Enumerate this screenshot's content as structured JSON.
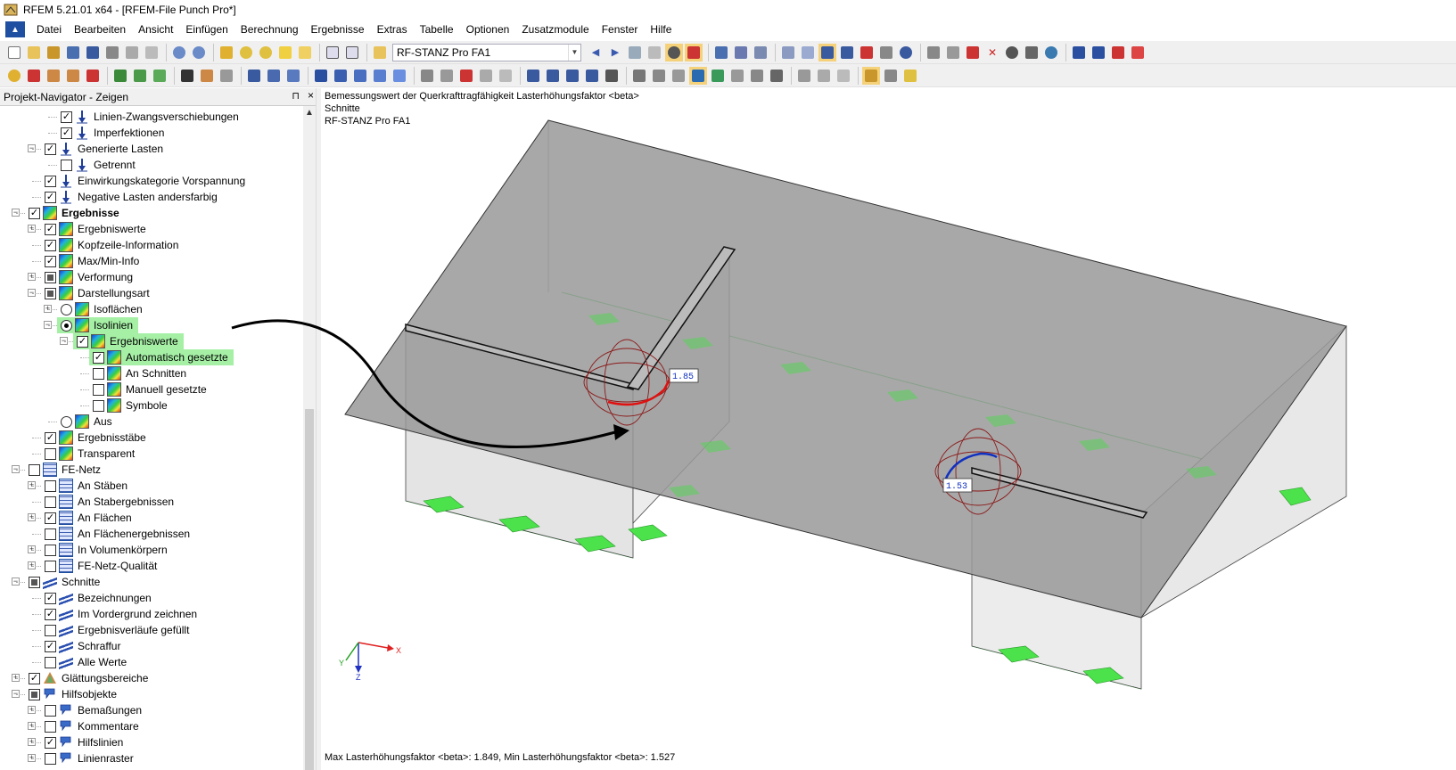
{
  "window": {
    "title": "RFEM 5.21.01 x64 - [RFEM-File Punch Pro*]"
  },
  "menu": [
    "Datei",
    "Bearbeiten",
    "Ansicht",
    "Einfügen",
    "Berechnung",
    "Ergebnisse",
    "Extras",
    "Tabelle",
    "Optionen",
    "Zusatzmodule",
    "Fenster",
    "Hilfe"
  ],
  "toolbar": {
    "combo_value": "RF-STANZ Pro FA1"
  },
  "navigator": {
    "title": "Projekt-Navigator - Zeigen",
    "items": [
      {
        "label": "Linien-Zwangsverschiebungen",
        "check": "on",
        "icon": "load"
      },
      {
        "label": "Imperfektionen",
        "check": "on",
        "icon": "load"
      },
      {
        "label": "Generierte Lasten",
        "check": "on",
        "icon": "load"
      },
      {
        "label": "Getrennt",
        "check": "off",
        "icon": "load"
      },
      {
        "label": "Einwirkungskategorie Vorspannung",
        "check": "on",
        "icon": "load"
      },
      {
        "label": "Negative Lasten andersfarbig",
        "check": "on",
        "icon": "load"
      },
      {
        "label": "Ergebnisse",
        "check": "on",
        "icon": "res"
      },
      {
        "label": "Ergebniswerte",
        "check": "on",
        "icon": "res"
      },
      {
        "label": "Kopfzeile-Information",
        "check": "on",
        "icon": "res"
      },
      {
        "label": "Max/Min-Info",
        "check": "on",
        "icon": "res"
      },
      {
        "label": "Verformung",
        "check": "partial",
        "icon": "res"
      },
      {
        "label": "Darstellungsart",
        "check": "partial",
        "icon": "res"
      },
      {
        "label": "Isoflächen",
        "check": "radio-off",
        "icon": "res"
      },
      {
        "label": "Isolinien",
        "check": "radio-on",
        "icon": "res"
      },
      {
        "label": "Ergebniswerte",
        "check": "on",
        "icon": "res"
      },
      {
        "label": "Automatisch gesetzte",
        "check": "on",
        "icon": "res"
      },
      {
        "label": "An Schnitten",
        "check": "off",
        "icon": "res"
      },
      {
        "label": "Manuell gesetzte",
        "check": "off",
        "icon": "res"
      },
      {
        "label": "Symbole",
        "check": "off",
        "icon": "res"
      },
      {
        "label": "Aus",
        "check": "radio-off",
        "icon": "res"
      },
      {
        "label": "Ergebnisstäbe",
        "check": "on",
        "icon": "res"
      },
      {
        "label": "Transparent",
        "check": "off",
        "icon": "res"
      },
      {
        "label": "FE-Netz",
        "check": "off",
        "icon": "mesh"
      },
      {
        "label": "An Stäben",
        "check": "off",
        "icon": "mesh"
      },
      {
        "label": "An Stabergebnissen",
        "check": "off",
        "icon": "mesh"
      },
      {
        "label": "An Flächen",
        "check": "on",
        "icon": "mesh"
      },
      {
        "label": "An Flächenergebnissen",
        "check": "off",
        "icon": "mesh"
      },
      {
        "label": "In Volumenkörpern",
        "check": "off",
        "icon": "mesh"
      },
      {
        "label": "FE-Netz-Qualität",
        "check": "off",
        "icon": "mesh"
      },
      {
        "label": "Schnitte",
        "check": "partial",
        "icon": "cut"
      },
      {
        "label": "Bezeichnungen",
        "check": "on",
        "icon": "cut"
      },
      {
        "label": "Im Vordergrund zeichnen",
        "check": "on",
        "icon": "cut"
      },
      {
        "label": "Ergebnisverläufe gefüllt",
        "check": "off",
        "icon": "cut"
      },
      {
        "label": "Schraffur",
        "check": "on",
        "icon": "cut"
      },
      {
        "label": "Alle Werte",
        "check": "off",
        "icon": "cut"
      },
      {
        "label": "Glättungsbereiche",
        "check": "on",
        "icon": "smooth"
      },
      {
        "label": "Hilfsobjekte",
        "check": "partial",
        "icon": "aux"
      },
      {
        "label": "Bemaßungen",
        "check": "off",
        "icon": "aux"
      },
      {
        "label": "Kommentare",
        "check": "off",
        "icon": "aux"
      },
      {
        "label": "Hilfslinien",
        "check": "on",
        "icon": "aux"
      },
      {
        "label": "Linienraster",
        "check": "off",
        "icon": "aux"
      }
    ]
  },
  "viewport": {
    "header_line1": "Bemessungswert der Querkrafttragfähigkeit Lasterhöhungsfaktor <beta>",
    "header_line2": "Schnitte",
    "header_line3": "RF-STANZ Pro FA1",
    "label_1": "1.85",
    "label_2": "1.53",
    "axis_x": "X",
    "axis_y": "Y",
    "axis_z": "Z",
    "footer": "Max Lasterhöhungsfaktor <beta>: 1.849, Min Lasterhöhungsfaktor <beta>: 1.527"
  }
}
